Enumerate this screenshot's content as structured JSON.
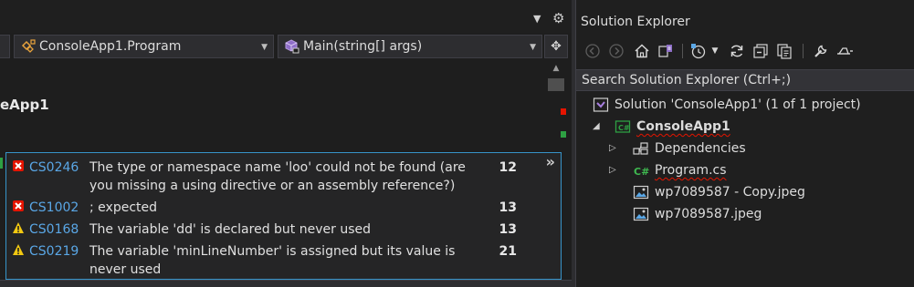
{
  "editor": {
    "navbar": {
      "class_dropdown": "ConsoleApp1.Program",
      "member_dropdown": "Main(string[] args)"
    },
    "code_fragment": "eApp1"
  },
  "error_popup": {
    "expand_glyph": "»",
    "errors": [
      {
        "severity": "error",
        "code": "CS0246",
        "message": "The type or namespace name 'loo' could not be found (are you missing a using directive or an assembly reference?)",
        "line": "12"
      },
      {
        "severity": "error",
        "code": "CS1002",
        "message": "; expected",
        "line": "13"
      },
      {
        "severity": "warning",
        "code": "CS0168",
        "message": "The variable 'dd' is declared but never used",
        "line": "13"
      },
      {
        "severity": "warning",
        "code": "CS0219",
        "message": "The variable 'minLineNumber' is assigned but its value is never used",
        "line": "21"
      }
    ]
  },
  "solution_explorer": {
    "title": "Solution Explorer",
    "search_placeholder": "Search Solution Explorer (Ctrl+;)",
    "tree": {
      "solution": "Solution 'ConsoleApp1' (1 of 1 project)",
      "project": "ConsoleApp1",
      "dependencies": "Dependencies",
      "program": "Program.cs",
      "image1": "wp7089587 - Copy.jpeg",
      "image2": "wp7089587.jpeg"
    }
  },
  "colors": {
    "error": "#e51400",
    "warning": "#f2c811",
    "link": "#5aa7e6",
    "accent_border": "#3794c9"
  }
}
